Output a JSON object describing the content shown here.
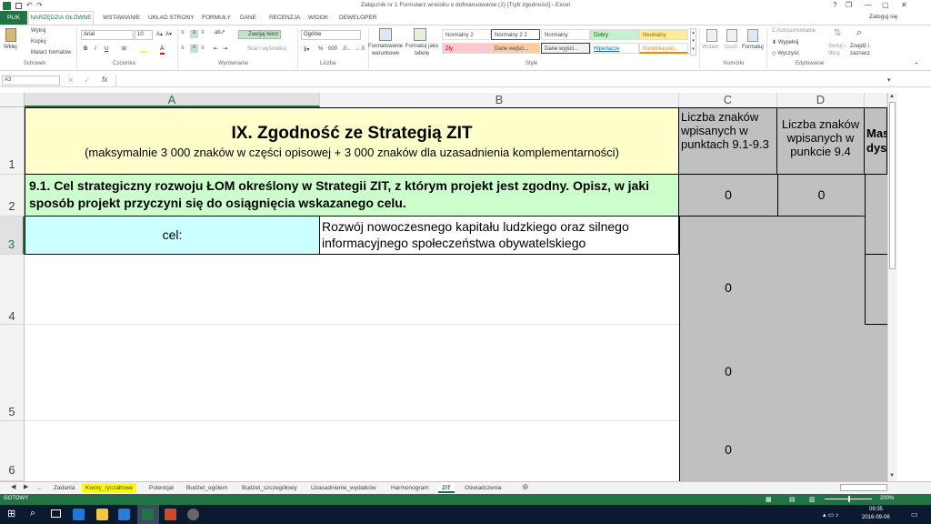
{
  "window": {
    "title": "Załącznik nr 1 Formularz wniosku o dofinansowanie (2)  [Tryb zgodności] - Excel",
    "help": "?",
    "restore": "❐",
    "minimize": "—",
    "restore2": "▢",
    "close": "✕",
    "login": "Zaloguj się"
  },
  "tabs": [
    "PLIK",
    "NARZĘDZIA GŁÓWNE",
    "WSTAWIANIE",
    "UKŁAD STRONY",
    "FORMUŁY",
    "DANE",
    "RECENZJA",
    "WIDOK",
    "DEWELOPER"
  ],
  "ribbon": {
    "clipboard": {
      "paste": "Wklej",
      "cut": "Wytnij",
      "copy": "Kopiuj",
      "painter": "Malarz formatów",
      "label": "Schowek"
    },
    "font": {
      "name": "Arial",
      "size": "10",
      "bold": "B",
      "italic": "I",
      "underline": "U",
      "label": "Czcionka"
    },
    "align": {
      "wrap": "Zawijaj tekst",
      "merge": "Scal i wyśrodkuj",
      "label": "Wyrównanie"
    },
    "number": {
      "format": "Ogólne",
      "percent": "%",
      "thousands": "000",
      "label": "Liczba"
    },
    "styles": {
      "cond": "Formatowanie warunkowe",
      "table": "Formatuj jako tabelę",
      "cells": [
        [
          "Normalny 2",
          "Normalny 2 2",
          "Normalny",
          "Dobry",
          "Neutralny"
        ],
        [
          "Zły",
          "Dane wejści...",
          "Dane wyjści...",
          "Hiperłącze",
          "Komórka poł..."
        ]
      ],
      "label": "Style"
    },
    "cells_grp": {
      "insert": "Wstaw",
      "delete": "Usuń",
      "format": "Formatuj",
      "label": "Komórki"
    },
    "editing": {
      "autosum": "Autosumowanie",
      "fill": "Wypełnij",
      "clear": "Wyczyść",
      "sort": "Sortuj i filtruj",
      "find": "Znajdź i zaznacz",
      "label": "Edytowanie"
    }
  },
  "formula_bar": {
    "name_box": "A3",
    "fx": "fx",
    "value": ""
  },
  "columns": [
    "A",
    "B",
    "C",
    "D",
    "Mas"
  ],
  "rows": [
    "1",
    "2",
    "3",
    "4",
    "5",
    "6"
  ],
  "cells": {
    "r1_title": "IX. Zgodność ze Strategią ZIT",
    "r1_sub": "(maksymalnie 3 000 znaków w części opisowej + 3 000 znaków dla uzasadnienia komplementarności)",
    "c1_head": "Liczba znaków wpisanych w punktach 9.1-9.3",
    "d1_head": "Liczba znaków wpisanych w punkcie 9.4",
    "e1_head": "Mas dys",
    "r2_text": "9.1. Cel strategiczny rozwoju ŁOM określony w Strategii ZIT, z którym projekt jest zgodny. Opisz, w jaki sposób projekt przyczyni się do osiągnięcia wskazanego celu.",
    "c2": "0",
    "d2": "0",
    "a3": "cel:",
    "b3": "Rozwój nowoczesnego kapitału ludzkiego oraz silnego informacyjnego społeczeństwa obywatelskiego",
    "c4": "0",
    "c5": "0",
    "c6": "0"
  },
  "sheet_tabs": [
    "...",
    "Zadania",
    "Kwoty_ryczałtowe",
    "Potencjał",
    "Budżet_ogólem",
    "Budżet_szczegółowy",
    "Uzasadnienie_wydatków",
    "Harmonogram",
    "ZIT",
    "Oświadczenia"
  ],
  "active_sheet": "ZIT",
  "status": {
    "ready": "GOTOWY",
    "zoom": "200%"
  },
  "taskbar": {
    "time": "09:35",
    "date": "2016-09-06"
  },
  "colors": {
    "excel_green": "#217346",
    "title_yellow": "#ffffcc",
    "section_green": "#ccffcc",
    "cel_cyan": "#ccffff",
    "gray": "#c0c0c0",
    "tab_yellow": "#ffff00"
  }
}
